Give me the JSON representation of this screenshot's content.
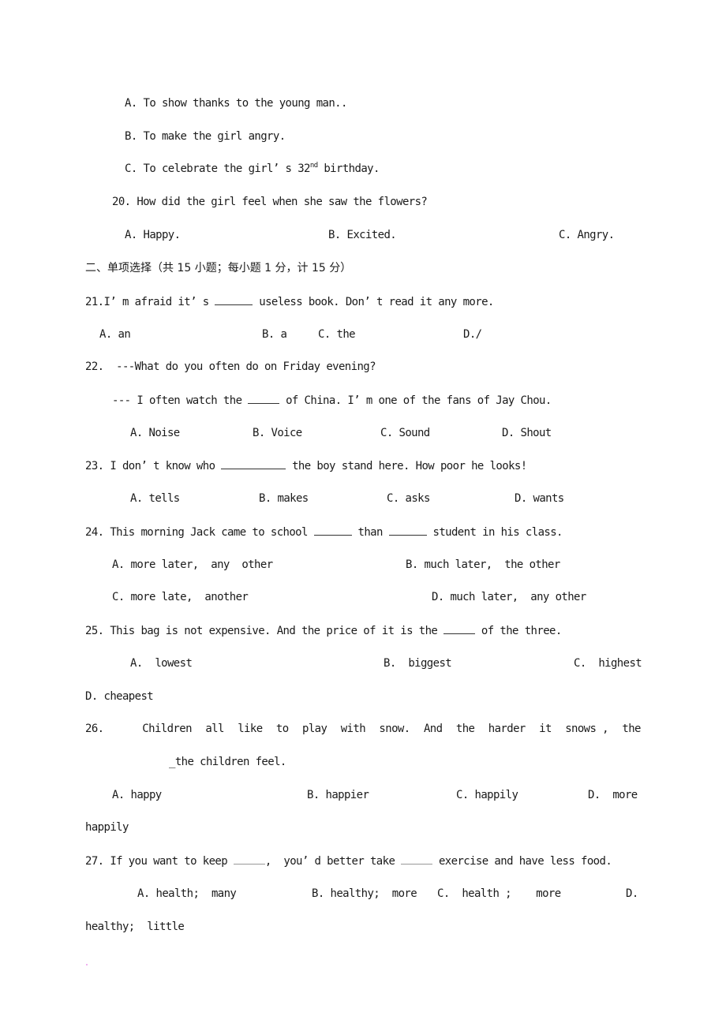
{
  "q19_options": {
    "a": "A. To show thanks to the young man..",
    "b": "B. To make the girl angry.",
    "c_prefix": "C. To celebrate the girl’ s 32",
    "c_sup": "nd",
    "c_suffix": " birthday."
  },
  "q20": {
    "question": "20. How did the girl feel when she saw the flowers?",
    "options": [
      "A. Happy.",
      "B. Excited.",
      "C. Angry."
    ]
  },
  "section_heading": "二、单项选择（共 15 小题；每小题 1 分，计 15 分）",
  "q21": {
    "prefix": "21.I’ m afraid it’ s ",
    "suffix": " useless book. Don’ t read it any more.",
    "options": [
      "A. an",
      "B. a",
      "C. the",
      "D./"
    ]
  },
  "q22": {
    "question": "22.  ---What do you often do on Friday evening?",
    "answer_prefix": "--- I often watch the ",
    "answer_suffix": " of China. I’ m one of the fans of Jay Chou.",
    "options": [
      "A. Noise",
      "B. Voice",
      "C. Sound",
      "D. Shout"
    ]
  },
  "q23": {
    "prefix": "23. I don’ t know who ",
    "suffix": " the boy stand here. How poor he looks!",
    "options": [
      "A. tells",
      "B. makes",
      "C. asks",
      "D. wants"
    ]
  },
  "q24": {
    "prefix": "24. This morning Jack came to school ",
    "middle": " than ",
    "suffix": " student in his class.",
    "options": [
      "A. more later,  any  other",
      "B. much later,  the other",
      "C. more late,  another",
      "D. much later,  any other"
    ]
  },
  "q25": {
    "prefix": "25. This bag is not expensive. And the price of it is the ",
    "suffix": " of the three.",
    "options": [
      "A.  lowest",
      "B.  biggest",
      "C.  highest",
      "D. cheapest"
    ]
  },
  "q26": {
    "number": "26.",
    "words": [
      "Children",
      "all",
      "like",
      "to",
      "play",
      "with",
      "snow.",
      "And",
      "the",
      "harder",
      "it",
      "snows ,",
      "the"
    ],
    "continuation": "_the children feel.",
    "options": [
      "A. happy",
      "B. happier",
      "C. happily",
      "D.  more"
    ],
    "option_wrap": "happily"
  },
  "q27": {
    "prefix": "27. If you want to keep ",
    "middle": ",  you’ d better take ",
    "suffix": " exercise and have less food.",
    "options": [
      "A. health;  many",
      "B. healthy;  more",
      "C.  health ;    more",
      "D."
    ],
    "option_wrap": "healthy;  little"
  }
}
